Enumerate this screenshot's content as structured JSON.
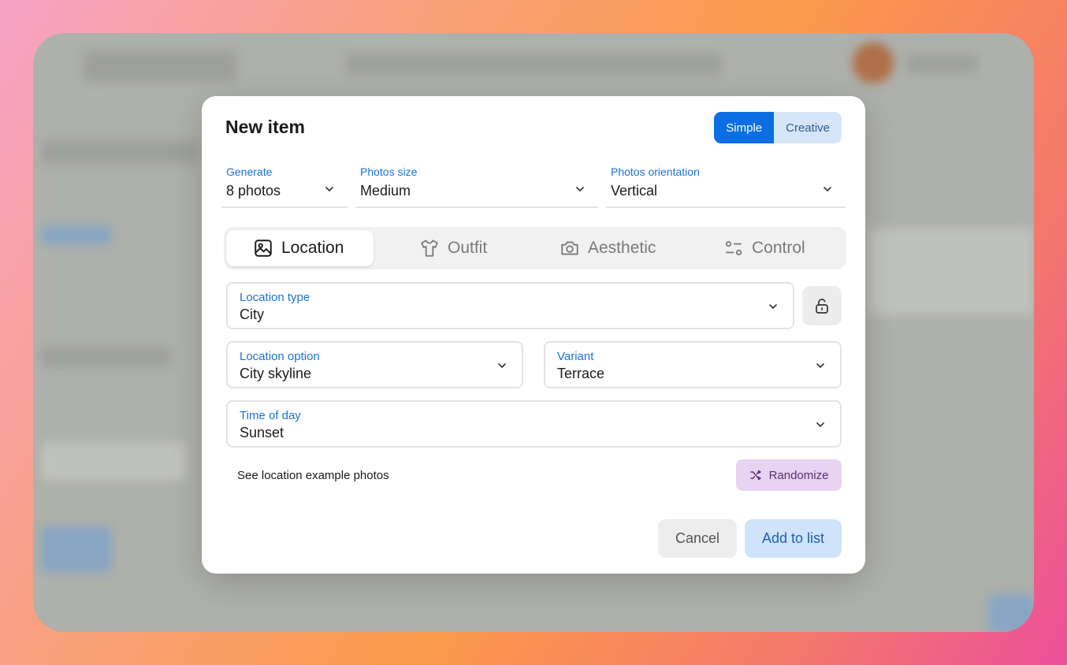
{
  "modal": {
    "title": "New item",
    "modes": [
      "Simple",
      "Creative"
    ],
    "active_mode": "Simple"
  },
  "top_selects": [
    {
      "label": "Generate",
      "value": "8 photos"
    },
    {
      "label": "Photos size",
      "value": "Medium"
    },
    {
      "label": "Photos orientation",
      "value": "Vertical"
    }
  ],
  "tabs": [
    {
      "label": "Location",
      "icon": "image-icon",
      "active": true
    },
    {
      "label": "Outfit",
      "icon": "shirt-icon",
      "active": false
    },
    {
      "label": "Aesthetic",
      "icon": "camera-icon",
      "active": false
    },
    {
      "label": "Control",
      "icon": "sliders-icon",
      "active": false
    }
  ],
  "fields": {
    "location_type": {
      "label": "Location type",
      "value": "City"
    },
    "location_option": {
      "label": "Location option",
      "value": "City skyline"
    },
    "variant": {
      "label": "Variant",
      "value": "Terrace"
    },
    "time_of_day": {
      "label": "Time of day",
      "value": "Sunset"
    }
  },
  "example_link": "See location example photos",
  "randomize_label": "Randomize",
  "actions": {
    "cancel": "Cancel",
    "add": "Add to list"
  },
  "colors": {
    "accent": "#0b6fe3",
    "label_blue": "#1a73d6",
    "randomize_bg": "#e8d3f2"
  }
}
